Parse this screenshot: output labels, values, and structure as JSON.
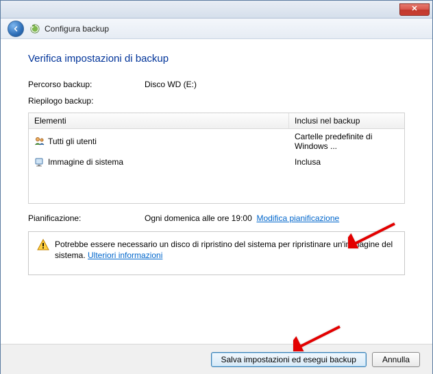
{
  "header": {
    "breadcrumb": "Configura backup"
  },
  "main": {
    "title": "Verifica impostazioni di backup",
    "location_label": "Percorso backup:",
    "location_value": "Disco WD (E:)",
    "summary_label": "Riepilogo backup:",
    "table": {
      "col_items": "Elementi",
      "col_included": "Inclusi nel backup",
      "rows": [
        {
          "name": "Tutti gli utenti",
          "included": "Cartelle predefinite di Windows ..."
        },
        {
          "name": "Immagine di sistema",
          "included": "Inclusa"
        }
      ]
    },
    "schedule_label": "Pianificazione:",
    "schedule_value": "Ogni domenica alle ore 19:00",
    "modify_schedule": "Modifica pianificazione",
    "warning_text": "Potrebbe essere necessario un disco di ripristino del sistema per ripristinare un'immagine del sistema. ",
    "more_info": "Ulteriori informazioni"
  },
  "footer": {
    "save_run": "Salva impostazioni ed esegui backup",
    "cancel": "Annulla"
  }
}
